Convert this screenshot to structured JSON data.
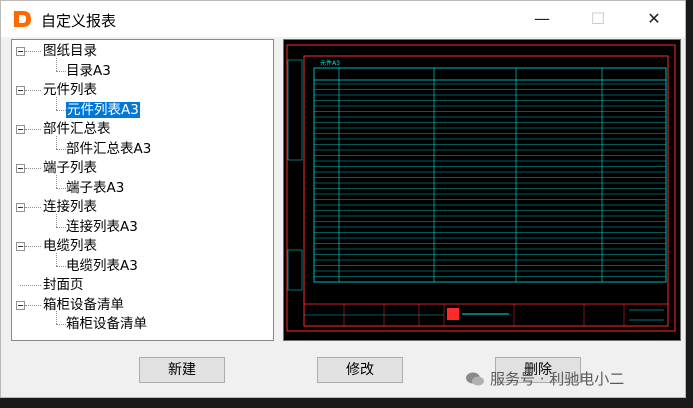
{
  "window": {
    "title": "自定义报表",
    "minimize_glyph": "—",
    "maximize_glyph": "☐",
    "close_glyph": "✕"
  },
  "colors": {
    "selection": "#0078d7",
    "preview_bg": "#000000",
    "drawing_red": "#ff2a2a",
    "drawing_cyan": "#00e5e5",
    "app_icon": "#ff6a00"
  },
  "tree": {
    "groups": [
      {
        "label": "图纸目录",
        "children": [
          "目录A3"
        ]
      },
      {
        "label": "元件列表",
        "children": [
          "元件列表A3"
        ]
      },
      {
        "label": "部件汇总表",
        "children": [
          "部件汇总表A3"
        ]
      },
      {
        "label": "端子列表",
        "children": [
          "端子表A3"
        ]
      },
      {
        "label": "连接列表",
        "children": [
          "连接列表A3"
        ]
      },
      {
        "label": "电缆列表",
        "children": [
          "电缆列表A3"
        ]
      },
      {
        "label": "封面页",
        "children": []
      },
      {
        "label": "箱柜设备清单",
        "children": [
          "箱柜设备清单"
        ]
      }
    ],
    "selected": "元件列表A3"
  },
  "buttons": {
    "new": "新建",
    "edit": "修改",
    "delete": "删除"
  },
  "watermark": {
    "text": "服务号 · 利驰电小二",
    "icon": "wechat-icon"
  },
  "preview": {
    "sheet_label": "元件A3"
  }
}
